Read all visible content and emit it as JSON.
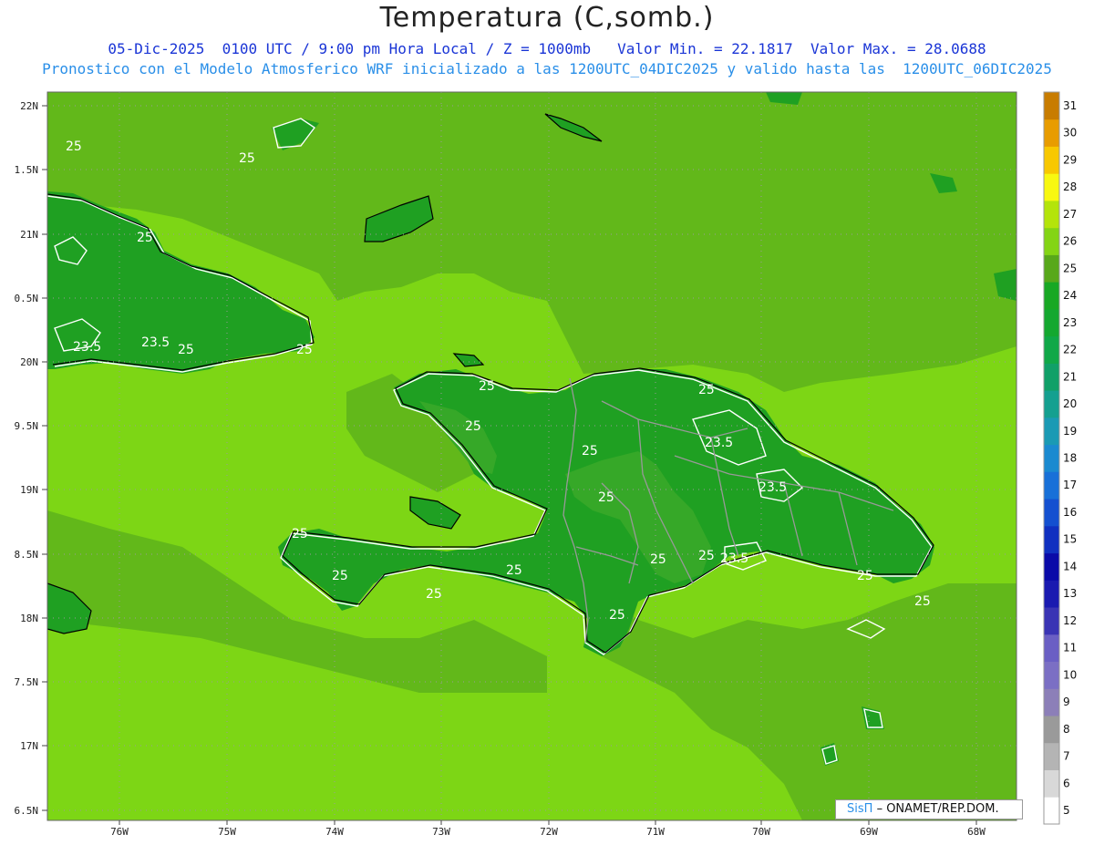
{
  "header": {
    "title": "Temperatura (C,somb.)",
    "subtitle_line1": "05-Dic-2025  0100 UTC / 9:00 pm Hora Local / Z = 1000mb   Valor Min. = 22.1817  Valor Max. = 28.0688",
    "subtitle_line2": "Pronostico con el Modelo Atmosferico WRF inicializado a las 1200UTC_04DIC2025 y valido hasta las  1200UTC_06DIC2025"
  },
  "axes": {
    "lat_ticks": [
      "22N",
      "1.5N",
      "21N",
      "0.5N",
      "20N",
      "9.5N",
      "19N",
      "8.5N",
      "18N",
      "7.5N",
      "17N",
      "6.5N"
    ],
    "lon_ticks": [
      "76W",
      "75W",
      "74W",
      "73W",
      "72W",
      "71W",
      "70W",
      "69W",
      "68W"
    ]
  },
  "colorbar": {
    "levels": [
      "5",
      "6",
      "7",
      "8",
      "9",
      "10",
      "11",
      "12",
      "13",
      "14",
      "15",
      "16",
      "17",
      "18",
      "19",
      "20",
      "21",
      "22",
      "23",
      "24",
      "25",
      "26",
      "27",
      "28",
      "29",
      "30",
      "31"
    ],
    "colors": [
      "#ffffff",
      "#d8d8d8",
      "#b4b4b4",
      "#9a9a9a",
      "#8c7fb8",
      "#7b6fc4",
      "#6a5fc4",
      "#3a34b4",
      "#1a1ab0",
      "#0a0aa8",
      "#1030c0",
      "#1450d0",
      "#1870d8",
      "#1a8ad0",
      "#1a9ab4",
      "#14a090",
      "#10a068",
      "#10a848",
      "#14a830",
      "#18a824",
      "#58a81a",
      "#84d414",
      "#b4e40a",
      "#f8f810",
      "#f8c800",
      "#e89c00",
      "#c87c00"
    ]
  },
  "map": {
    "colors": {
      "sea_light": "#7dd615",
      "sea_mid": "#62b81a",
      "land_dark": "#1fa022",
      "land_mid": "#36a828",
      "contour": "#ffffff",
      "coast": "#000000",
      "border": "#999999"
    },
    "contour_labels": [
      "25",
      "25",
      "25",
      "23.5",
      "23.5",
      "25",
      "25",
      "25",
      "25",
      "25",
      "23.5",
      "25",
      "23.5",
      "25",
      "25",
      "25",
      "25",
      "25",
      "25",
      "25",
      "23.5",
      "25",
      "25",
      "25"
    ]
  },
  "credit": {
    "brand": "SisΠ",
    "text": "– ONAMET/REP.DOM."
  }
}
